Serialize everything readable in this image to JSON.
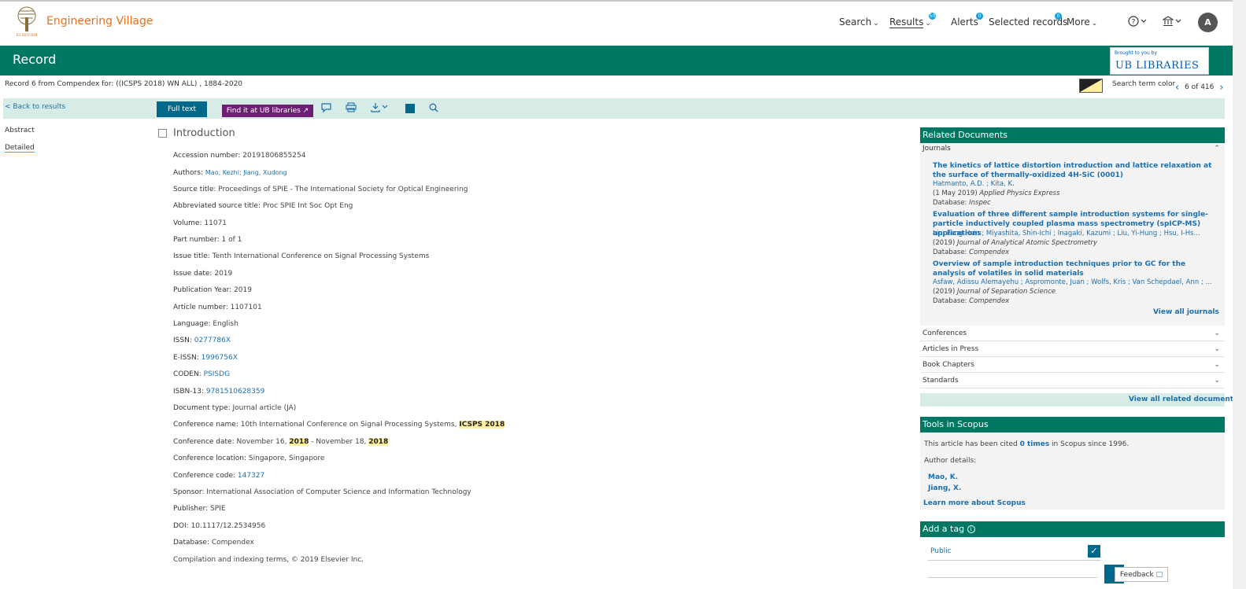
{
  "header": {
    "brand": "Engineering Village",
    "logo_caption": "ELSEVIER",
    "nav": {
      "search": "Search",
      "results": "Results",
      "results_badge": "50",
      "alerts": "Alerts",
      "alerts_badge": "0",
      "selected": "Selected records",
      "selected_badge": "0",
      "more": "More"
    },
    "avatar_initial": "A"
  },
  "title_band": {
    "title": "Record",
    "ub_small": "Brought to you by",
    "ub_big": "UB LIBRARIES"
  },
  "record_line": "Record 6 from Compendex for: ((ICSPS 2018) WN ALL) , 1884-2020",
  "search_term_color": "Search term color",
  "pager": {
    "position": "6 of 416"
  },
  "toolbar": {
    "back": "< Back to results",
    "full_text": "Full text",
    "find_it": "Find it at UB libraries ↗"
  },
  "left_tabs": {
    "abstract": "Abstract",
    "detailed": "Detailed"
  },
  "record": {
    "title": "Introduction",
    "accession": {
      "label": "Accession number:",
      "value": "20191806855254"
    },
    "authors": {
      "label": "Authors:",
      "value": "Mao, Kezhi; Jiang, Xudong"
    },
    "source_title": {
      "label": "Source title:",
      "value": "Proceedings of SPIE - The International Society for Optical Engineering"
    },
    "abbr_source": {
      "label": "Abbreviated source title:",
      "value": "Proc SPIE Int Soc Opt Eng"
    },
    "volume": {
      "label": "Volume:",
      "value": "11071"
    },
    "part": {
      "label": "Part number:",
      "value": "1 of 1"
    },
    "issue_title": {
      "label": "Issue title:",
      "value": "Tenth International Conference on Signal Processing Systems"
    },
    "issue_date": {
      "label": "Issue date:",
      "value": "2019"
    },
    "pub_year": {
      "label": "Publication Year:",
      "value": "2019"
    },
    "article_number": {
      "label": "Article number:",
      "value": "1107101"
    },
    "language": {
      "label": "Language:",
      "value": "English"
    },
    "issn": {
      "label": "ISSN:",
      "value": "0277786X"
    },
    "eissn": {
      "label": "E-ISSN:",
      "value": "1996756X"
    },
    "coden": {
      "label": "CODEN:",
      "value": "PSISDG"
    },
    "isbn": {
      "label": "ISBN-13:",
      "value": "9781510628359"
    },
    "doc_type": {
      "label": "Document type:",
      "value": "Journal article (JA)"
    },
    "conf_name": {
      "label": "Conference name:",
      "value": "10th International Conference on Signal Processing Systems, ",
      "highlight": "ICSPS 2018"
    },
    "conf_date": {
      "label": "Conference date:",
      "part1": "November 16, ",
      "hl1": "2018",
      "part2": " - November 18, ",
      "hl2": "2018"
    },
    "conf_location": {
      "label": "Conference location:",
      "value": "Singapore, Singapore"
    },
    "conf_code": {
      "label": "Conference code:",
      "value": "147327"
    },
    "sponsor": {
      "label": "Sponsor:",
      "value": "International Association of Computer Science and Information Technology"
    },
    "publisher": {
      "label": "Publisher:",
      "value": "SPIE"
    },
    "doi": {
      "label": "DOI:",
      "value": "10.1117/12.2534956"
    },
    "database": {
      "label": "Database:",
      "value": "Compendex"
    },
    "copyright": "Compilation and indexing terms, © 2019 Elsevier Inc."
  },
  "related": {
    "heading": "Related Documents",
    "journals_label": "Journals",
    "docs": [
      {
        "title": "The kinetics of lattice distortion introduction and lattice relaxation at the surface of thermally-oxidized 4H-SiC (0001)",
        "authors": "Hatmanto, A.D. ; Kita, K.",
        "date": "(1 May 2019) ",
        "journal": "Applied Physics Express",
        "db_label": "Database: ",
        "db": "Inspec"
      },
      {
        "title": "Evaluation of three different sample introduction systems for single-particle inductively coupled plasma mass spectrometry (spICP-MS) applications",
        "authors": "Lin, Fang-Hsin ; Miyashita, Shin-Ichi ; Inagaki, Kazumi ; Liu, Yi-Hung ; Hsu, I-Hs...",
        "date": "(2019) ",
        "journal": "Journal of Analytical Atomic Spectrometry",
        "db_label": "Database: ",
        "db": "Compendex"
      },
      {
        "title": "Overview of sample introduction techniques prior to GC for the analysis of volatiles in solid materials",
        "authors": "Asfaw, Adissu Alemayehu ; Aspromonte, Juan ; Wolfs, Kris ; Van Schepdael, Ann ; Ad...",
        "date": "(2019) ",
        "journal": "Journal of Separation Science",
        "db_label": "Database: ",
        "db": "Compendex"
      }
    ],
    "view_all_journals": "View all journals",
    "conferences": "Conferences",
    "articles_in_press": "Articles in Press",
    "book_chapters": "Book Chapters",
    "standards": "Standards",
    "view_all_related": "View all related documents"
  },
  "scopus": {
    "heading": "Tools in Scopus",
    "cited_pre": "This article has been cited ",
    "cited_link": "0 times",
    "cited_post": " in Scopus since 1996.",
    "author_details": "Author details:",
    "authors": [
      "Mao, K.",
      "Jiang, X."
    ],
    "learn_more": "Learn more about Scopus"
  },
  "tag": {
    "heading": "Add a tag",
    "public": "Public"
  },
  "feedback": "Feedback"
}
